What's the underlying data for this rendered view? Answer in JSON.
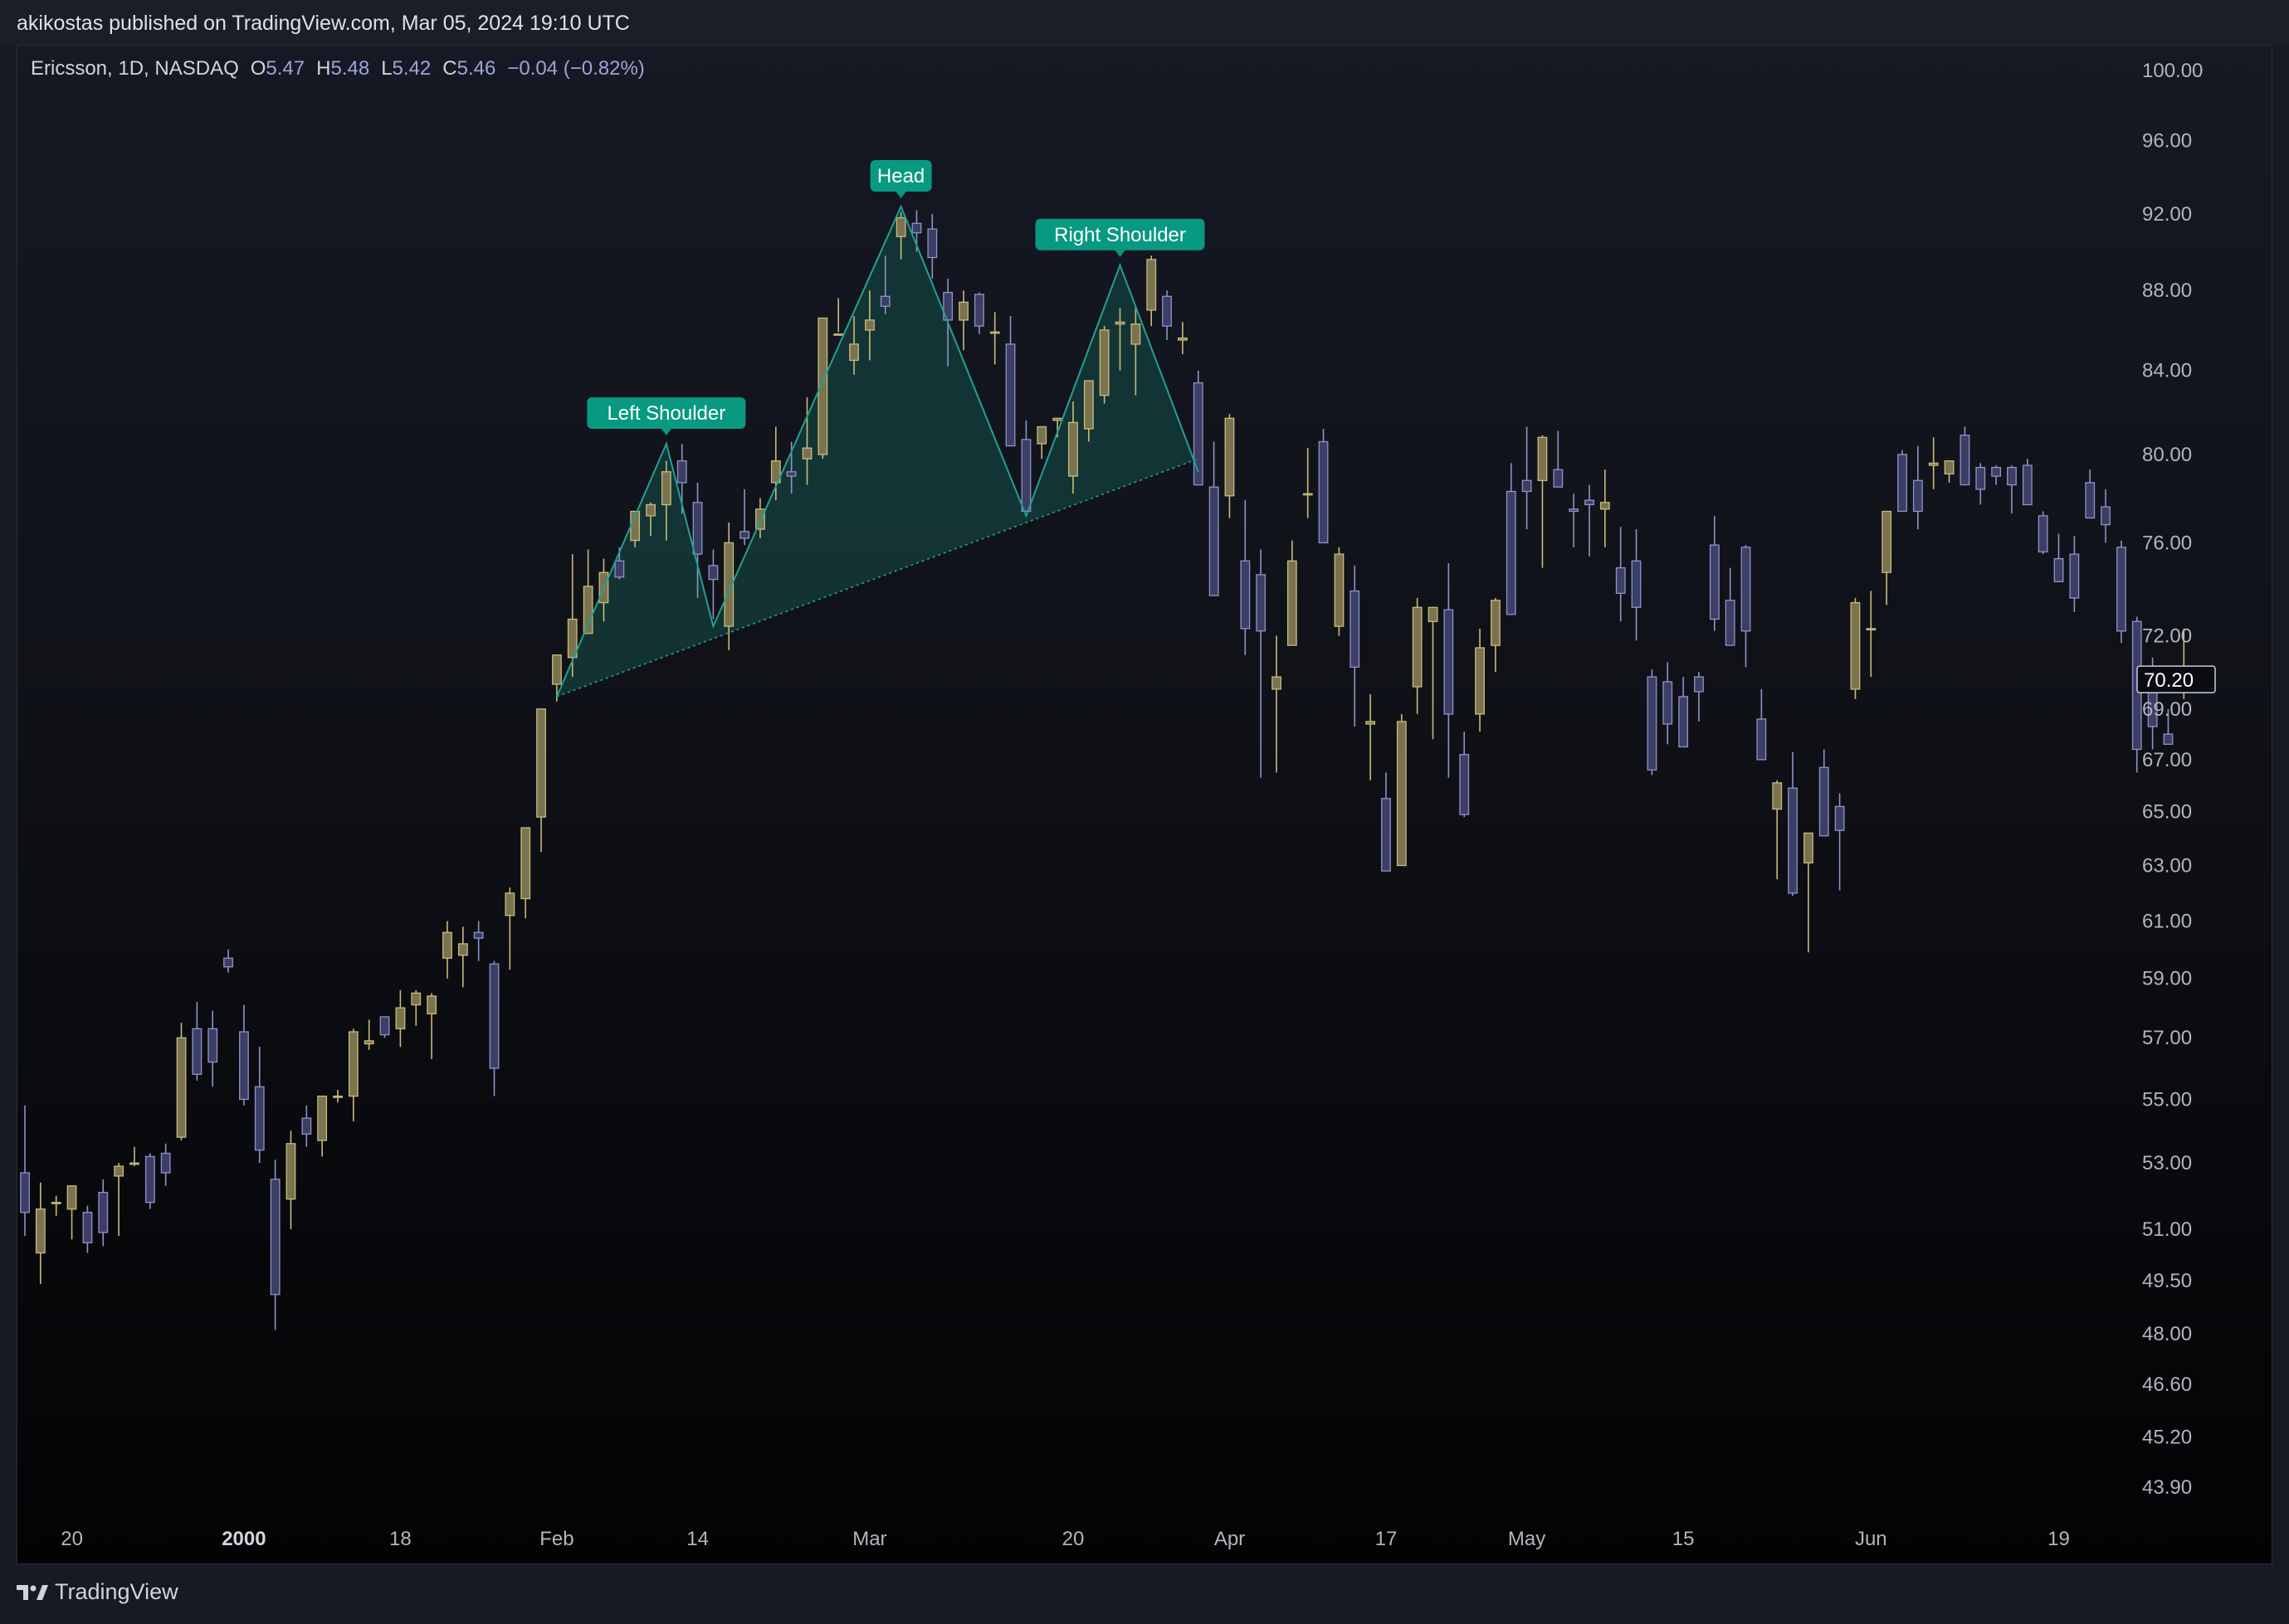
{
  "publisher_line": "akikostas published on TradingView.com, Mar 05, 2024 19:10 UTC",
  "legend": {
    "symbol": "Ericsson, 1D, NASDAQ",
    "open_label": "O",
    "open": "5.47",
    "high_label": "H",
    "high": "5.48",
    "low_label": "L",
    "low": "5.42",
    "close_label": "C",
    "close": "5.46",
    "change": "−0.04 (−0.82%)"
  },
  "branding": "TradingView",
  "colors": {
    "up_fill": "#7b7350",
    "up_border": "#c8bb79",
    "down_fill": "#3b3f66",
    "down_border": "#8f93c7",
    "pattern": "#22a093",
    "pattern_fill": "#143a38",
    "label_bg": "#089981",
    "price_label_border": "#c9cbe6"
  },
  "chart_data": {
    "type": "candlestick",
    "y_scale": "log",
    "y_tick_labels": [
      "100.00",
      "96.00",
      "92.00",
      "88.00",
      "84.00",
      "80.00",
      "76.00",
      "72.00",
      "69.00",
      "67.00",
      "65.00",
      "63.00",
      "61.00",
      "59.00",
      "57.00",
      "55.00",
      "53.00",
      "51.00",
      "49.50",
      "48.00",
      "46.60",
      "45.20",
      "43.90"
    ],
    "y_tick_values": [
      100,
      96,
      92,
      88,
      84,
      80,
      76,
      72,
      69,
      67,
      65,
      63,
      61,
      59,
      57,
      55,
      53,
      51,
      49.5,
      48,
      46.6,
      45.2,
      43.9
    ],
    "x_tick_labels": [
      "20",
      "2000",
      "18",
      "Feb",
      "14",
      "Mar",
      "20",
      "Apr",
      "17",
      "May",
      "15",
      "Jun",
      "19"
    ],
    "x_tick_bold": [
      false,
      true,
      false,
      false,
      false,
      false,
      false,
      false,
      false,
      false,
      false,
      false,
      false
    ],
    "x_tick_bar_index": [
      3,
      14,
      24,
      34,
      43,
      54,
      67,
      77,
      87,
      96,
      106,
      118,
      130
    ],
    "last_price_label": "70.20",
    "last_price": 70.2,
    "annotations": [
      {
        "text": "Left Shoulder",
        "bar_index": 41,
        "price": 80.5
      },
      {
        "text": "Head",
        "bar_index": 56,
        "price": 92.4
      },
      {
        "text": "Right Shoulder",
        "bar_index": 70,
        "price": 89.3
      }
    ],
    "pattern_points": [
      [
        34,
        69.5
      ],
      [
        41,
        80.5
      ],
      [
        44,
        72.4
      ],
      [
        56,
        92.4
      ],
      [
        64,
        77.2
      ],
      [
        70,
        89.3
      ],
      [
        75,
        79.2
      ]
    ],
    "neckline": [
      [
        34,
        69.5
      ],
      [
        75,
        79.8
      ]
    ],
    "candles": [
      [
        52.7,
        54.8,
        50.8,
        51.5
      ],
      [
        50.3,
        52.4,
        49.4,
        51.6
      ],
      [
        51.8,
        52.0,
        51.4,
        51.8
      ],
      [
        51.6,
        52.2,
        50.7,
        52.3
      ],
      [
        51.5,
        51.7,
        50.3,
        50.6
      ],
      [
        52.1,
        52.5,
        50.5,
        50.9
      ],
      [
        52.6,
        53.0,
        50.8,
        52.9
      ],
      [
        53.0,
        53.5,
        52.9,
        53.0
      ],
      [
        53.2,
        53.3,
        51.6,
        51.8
      ],
      [
        53.3,
        53.6,
        52.3,
        52.7
      ],
      [
        53.8,
        57.5,
        53.7,
        57.0
      ],
      [
        57.3,
        58.2,
        55.6,
        55.8
      ],
      [
        57.3,
        57.9,
        55.4,
        56.2
      ],
      [
        59.7,
        60.0,
        59.2,
        59.4
      ],
      [
        57.2,
        58.1,
        54.8,
        55.0
      ],
      [
        55.4,
        56.7,
        53.0,
        53.4
      ],
      [
        52.5,
        53.1,
        48.1,
        49.1
      ],
      [
        51.9,
        54.0,
        51.0,
        53.6
      ],
      [
        54.4,
        54.8,
        53.5,
        53.9
      ],
      [
        53.7,
        55.0,
        53.2,
        55.1
      ],
      [
        55.1,
        55.3,
        54.9,
        55.1
      ],
      [
        55.1,
        57.3,
        54.3,
        57.2
      ],
      [
        56.8,
        57.6,
        56.6,
        56.9
      ],
      [
        57.7,
        57.7,
        57.0,
        57.1
      ],
      [
        57.3,
        58.6,
        56.7,
        58.0
      ],
      [
        58.1,
        58.6,
        57.4,
        58.5
      ],
      [
        57.8,
        58.5,
        56.3,
        58.4
      ],
      [
        59.7,
        61.0,
        59.0,
        60.6
      ],
      [
        59.8,
        60.8,
        58.7,
        60.2
      ],
      [
        60.6,
        61.0,
        59.6,
        60.4
      ],
      [
        59.5,
        59.6,
        55.1,
        56.0
      ],
      [
        61.2,
        62.2,
        59.3,
        62.0
      ],
      [
        61.8,
        63.1,
        61.1,
        64.4
      ],
      [
        64.8,
        68.3,
        63.5,
        69.0
      ],
      [
        70.0,
        70.8,
        69.3,
        71.2
      ],
      [
        71.1,
        75.5,
        70.3,
        72.7
      ],
      [
        72.1,
        75.7,
        72.6,
        74.1
      ],
      [
        73.4,
        75.3,
        72.6,
        74.7
      ],
      [
        75.2,
        75.8,
        74.4,
        74.5
      ],
      [
        76.1,
        77.4,
        75.8,
        77.4
      ],
      [
        77.2,
        77.8,
        76.3,
        77.7
      ],
      [
        77.7,
        79.7,
        76.1,
        79.2
      ],
      [
        79.7,
        80.5,
        77.3,
        78.7
      ],
      [
        77.8,
        78.7,
        73.6,
        75.5
      ],
      [
        75.0,
        75.7,
        72.7,
        74.4
      ],
      [
        72.4,
        76.9,
        71.4,
        76.0
      ],
      [
        76.5,
        78.4,
        75.9,
        76.2
      ],
      [
        76.6,
        78.0,
        76.2,
        77.5
      ],
      [
        78.7,
        81.3,
        77.9,
        79.7
      ],
      [
        79.2,
        80.6,
        78.2,
        79.0
      ],
      [
        79.8,
        82.7,
        78.6,
        80.3
      ],
      [
        80.0,
        86.0,
        79.8,
        86.6
      ],
      [
        85.8,
        87.6,
        85.9,
        85.8
      ],
      [
        84.5,
        86.7,
        83.8,
        85.3
      ],
      [
        86.0,
        88.0,
        84.5,
        86.5
      ],
      [
        87.7,
        89.8,
        86.8,
        87.2
      ],
      [
        90.8,
        92.1,
        89.6,
        91.8
      ],
      [
        91.5,
        92.2,
        90.0,
        91.0
      ],
      [
        91.2,
        92.0,
        88.6,
        89.7
      ],
      [
        87.9,
        88.6,
        84.2,
        86.5
      ],
      [
        86.5,
        88.0,
        85.0,
        87.4
      ],
      [
        87.8,
        87.9,
        85.8,
        86.2
      ],
      [
        85.9,
        86.9,
        84.3,
        85.9
      ],
      [
        85.3,
        86.7,
        82.1,
        80.4
      ],
      [
        80.7,
        81.6,
        78.5,
        77.4
      ],
      [
        80.5,
        81.3,
        79.8,
        81.3
      ],
      [
        81.6,
        81.6,
        80.8,
        81.7
      ],
      [
        79.0,
        82.5,
        78.2,
        81.5
      ],
      [
        81.2,
        83.2,
        80.6,
        83.5
      ],
      [
        82.8,
        86.2,
        82.4,
        86.0
      ],
      [
        86.3,
        87.1,
        84.0,
        86.4
      ],
      [
        85.3,
        87.2,
        82.8,
        86.3
      ],
      [
        87.0,
        89.8,
        86.2,
        89.6
      ],
      [
        87.7,
        88.0,
        85.5,
        86.2
      ],
      [
        85.5,
        86.4,
        84.8,
        85.6
      ],
      [
        83.4,
        84.0,
        82.5,
        78.6
      ],
      [
        78.5,
        80.6,
        74.5,
        73.7
      ],
      [
        78.1,
        81.9,
        77.1,
        81.7
      ],
      [
        75.2,
        77.9,
        71.2,
        72.3
      ],
      [
        74.6,
        75.7,
        66.3,
        72.2
      ],
      [
        69.8,
        72.0,
        66.5,
        70.3
      ],
      [
        71.6,
        76.1,
        72.0,
        75.2
      ],
      [
        78.2,
        80.3,
        77.1,
        78.2
      ],
      [
        80.6,
        81.2,
        76.8,
        76.0
      ],
      [
        72.4,
        75.8,
        72.0,
        75.5
      ],
      [
        73.9,
        75.0,
        68.3,
        70.7
      ],
      [
        68.4,
        69.6,
        66.2,
        68.5
      ],
      [
        65.5,
        66.5,
        63.0,
        62.8
      ],
      [
        63.0,
        68.8,
        63.7,
        68.5
      ],
      [
        69.9,
        73.6,
        68.8,
        73.2
      ],
      [
        72.6,
        72.8,
        67.8,
        73.2
      ],
      [
        73.1,
        75.1,
        66.3,
        68.8
      ],
      [
        67.2,
        68.1,
        64.8,
        64.9
      ],
      [
        68.8,
        72.3,
        68.1,
        71.5
      ],
      [
        71.6,
        73.6,
        70.5,
        73.5
      ],
      [
        78.3,
        79.6,
        76.8,
        72.9
      ],
      [
        78.8,
        81.3,
        76.6,
        78.3
      ],
      [
        78.8,
        80.9,
        74.9,
        80.8
      ],
      [
        79.3,
        81.1,
        78.6,
        78.5
      ],
      [
        77.5,
        78.2,
        75.8,
        77.4
      ],
      [
        77.9,
        78.6,
        75.4,
        77.7
      ],
      [
        77.5,
        79.3,
        75.8,
        77.8
      ],
      [
        74.9,
        76.7,
        72.6,
        73.8
      ],
      [
        75.2,
        76.6,
        71.8,
        73.2
      ],
      [
        70.3,
        70.6,
        66.4,
        66.6
      ],
      [
        70.1,
        70.9,
        67.6,
        68.4
      ],
      [
        69.5,
        70.3,
        67.5,
        67.5
      ],
      [
        70.3,
        70.5,
        68.5,
        69.7
      ],
      [
        75.9,
        77.2,
        72.2,
        72.7
      ],
      [
        73.5,
        74.9,
        71.9,
        71.6
      ],
      [
        75.8,
        75.9,
        70.7,
        72.2
      ],
      [
        68.6,
        69.8,
        67.7,
        67.0
      ],
      [
        65.1,
        66.2,
        62.5,
        66.1
      ],
      [
        65.9,
        67.3,
        61.9,
        62.0
      ],
      [
        63.1,
        63.9,
        59.9,
        64.2
      ],
      [
        66.7,
        67.4,
        64.3,
        64.1
      ],
      [
        65.2,
        65.7,
        62.1,
        64.3
      ],
      [
        69.8,
        73.6,
        69.4,
        73.4
      ],
      [
        72.3,
        73.9,
        70.3,
        72.3
      ],
      [
        74.7,
        77.1,
        73.3,
        77.4
      ],
      [
        80.0,
        80.2,
        78.6,
        77.4
      ],
      [
        78.8,
        80.4,
        76.6,
        77.4
      ],
      [
        79.5,
        80.8,
        78.4,
        79.6
      ],
      [
        79.1,
        79.5,
        78.7,
        79.7
      ],
      [
        80.9,
        81.3,
        78.6,
        78.6
      ],
      [
        79.4,
        79.6,
        77.7,
        78.4
      ],
      [
        79.4,
        79.5,
        78.6,
        79.0
      ],
      [
        79.4,
        79.5,
        77.3,
        78.6
      ],
      [
        79.5,
        79.8,
        78.0,
        77.7
      ],
      [
        77.2,
        77.4,
        75.5,
        75.6
      ],
      [
        75.3,
        76.4,
        74.8,
        74.3
      ],
      [
        75.5,
        76.3,
        73.0,
        73.6
      ],
      [
        78.7,
        79.3,
        77.9,
        77.1
      ],
      [
        77.6,
        78.4,
        76.0,
        76.8
      ],
      [
        75.8,
        76.1,
        71.7,
        72.2
      ],
      [
        72.6,
        72.8,
        66.5,
        67.4
      ],
      [
        70.4,
        71.1,
        67.4,
        68.3
      ],
      [
        68.0,
        69.0,
        67.7,
        67.6
      ],
      [
        70.2,
        72.3,
        69.4,
        70.6
      ]
    ]
  }
}
